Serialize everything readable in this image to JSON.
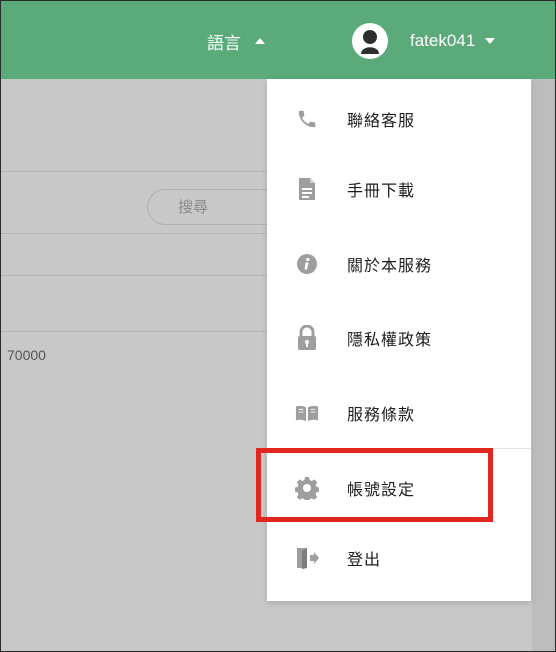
{
  "header": {
    "language_label": "語言",
    "username": "fatek041",
    "bg_color": "#5aaa7a"
  },
  "background": {
    "search_placeholder": "搜尋",
    "partial_value": "70000"
  },
  "user_menu": {
    "items": [
      {
        "label": "聯絡客服",
        "icon": "phone-icon"
      },
      {
        "label": "手冊下載",
        "icon": "document-icon"
      },
      {
        "label": "關於本服務",
        "icon": "info-icon"
      },
      {
        "label": "隱私權政策",
        "icon": "lock-icon"
      },
      {
        "label": "服務條款",
        "icon": "book-icon"
      },
      {
        "label": "帳號設定",
        "icon": "gear-icon"
      },
      {
        "label": "登出",
        "icon": "logout-icon"
      }
    ],
    "highlighted_item": "帳號設定",
    "highlight_color": "#e0261f"
  }
}
